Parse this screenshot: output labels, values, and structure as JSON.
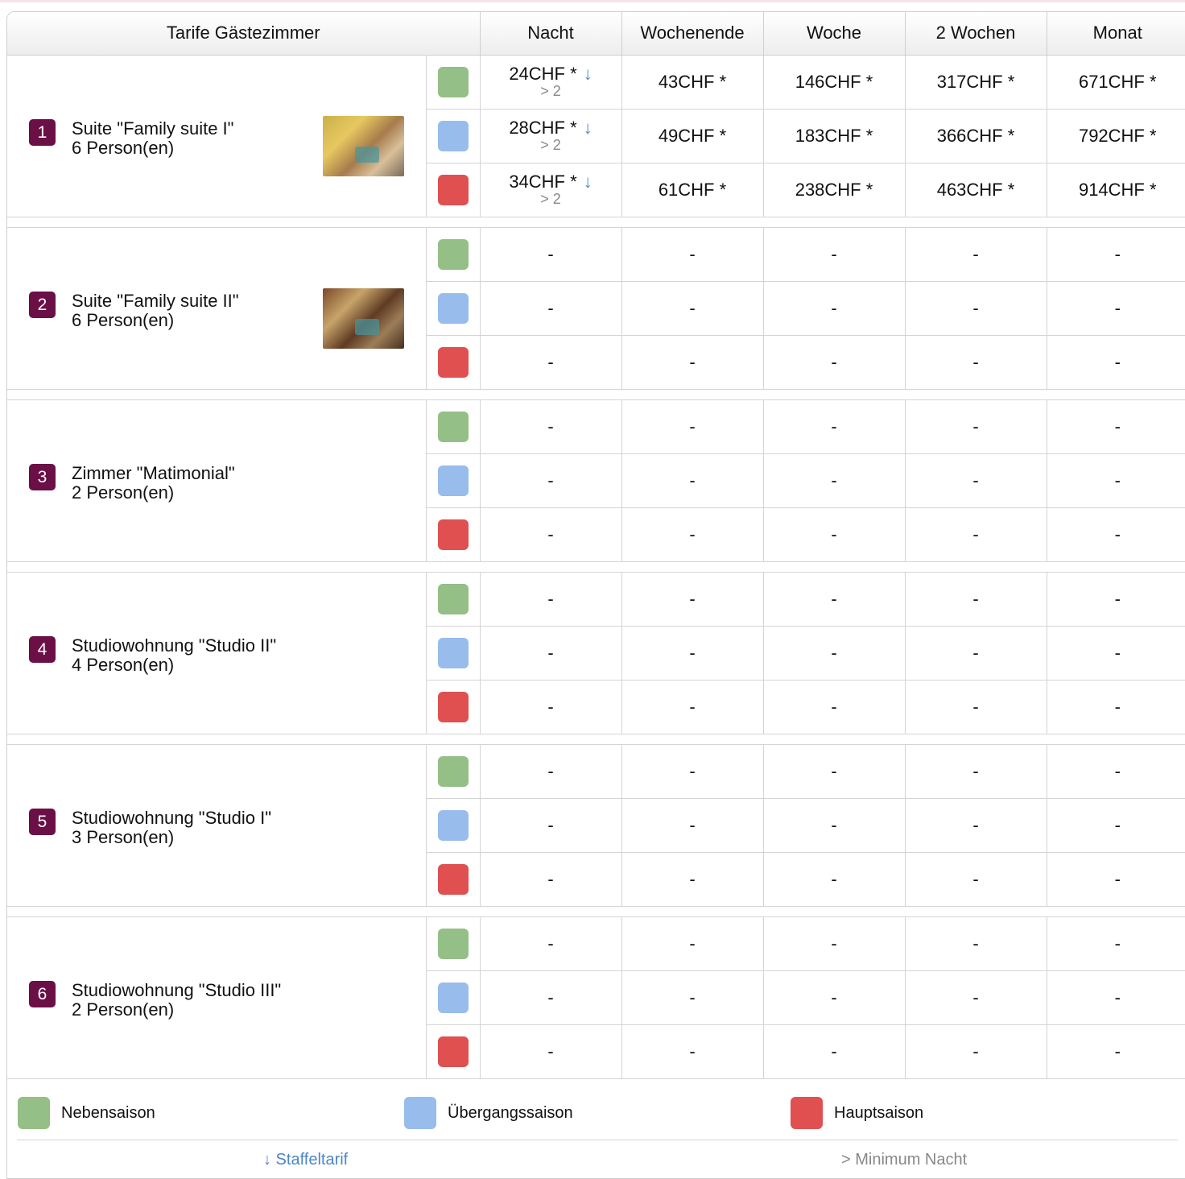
{
  "header": {
    "title": "Tarife Gästezimmer",
    "columns": [
      "Nacht",
      "Wochenende",
      "Woche",
      "2 Wochen",
      "Monat"
    ]
  },
  "colors": {
    "nebensaison": "#94bf86",
    "uebergangssaison": "#98bceb",
    "hauptsaison": "#e05050",
    "room_badge": "#6b0f47"
  },
  "rooms": [
    {
      "num": "1",
      "name": "Suite \"Family suite I\"",
      "persons": "6 Person(en)",
      "has_photo": true,
      "rates": [
        {
          "night": "24CHF *",
          "arrow": "↓",
          "min": "> 2",
          "weekend": "43CHF *",
          "week": "146CHF *",
          "two_weeks": "317CHF *",
          "month": "671CHF *"
        },
        {
          "night": "28CHF *",
          "arrow": "↓",
          "min": "> 2",
          "weekend": "49CHF *",
          "week": "183CHF *",
          "two_weeks": "366CHF *",
          "month": "792CHF *"
        },
        {
          "night": "34CHF *",
          "arrow": "↓",
          "min": "> 2",
          "weekend": "61CHF *",
          "week": "238CHF *",
          "two_weeks": "463CHF *",
          "month": "914CHF *"
        }
      ]
    },
    {
      "num": "2",
      "name": "Suite \"Family suite II\"",
      "persons": "6 Person(en)",
      "has_photo": true,
      "rates": [
        {
          "night": "-",
          "weekend": "-",
          "week": "-",
          "two_weeks": "-",
          "month": "-"
        },
        {
          "night": "-",
          "weekend": "-",
          "week": "-",
          "two_weeks": "-",
          "month": "-"
        },
        {
          "night": "-",
          "weekend": "-",
          "week": "-",
          "two_weeks": "-",
          "month": "-"
        }
      ]
    },
    {
      "num": "3",
      "name": "Zimmer \"Matimonial\"",
      "persons": "2 Person(en)",
      "has_photo": false,
      "rates": [
        {
          "night": "-",
          "weekend": "-",
          "week": "-",
          "two_weeks": "-",
          "month": "-"
        },
        {
          "night": "-",
          "weekend": "-",
          "week": "-",
          "two_weeks": "-",
          "month": "-"
        },
        {
          "night": "-",
          "weekend": "-",
          "week": "-",
          "two_weeks": "-",
          "month": "-"
        }
      ]
    },
    {
      "num": "4",
      "name": "Studiowohnung \"Studio II\"",
      "persons": "4 Person(en)",
      "has_photo": false,
      "rates": [
        {
          "night": "-",
          "weekend": "-",
          "week": "-",
          "two_weeks": "-",
          "month": "-"
        },
        {
          "night": "-",
          "weekend": "-",
          "week": "-",
          "two_weeks": "-",
          "month": "-"
        },
        {
          "night": "-",
          "weekend": "-",
          "week": "-",
          "two_weeks": "-",
          "month": "-"
        }
      ]
    },
    {
      "num": "5",
      "name": "Studiowohnung \"Studio I\"",
      "persons": "3 Person(en)",
      "has_photo": false,
      "rates": [
        {
          "night": "-",
          "weekend": "-",
          "week": "-",
          "two_weeks": "-",
          "month": "-"
        },
        {
          "night": "-",
          "weekend": "-",
          "week": "-",
          "two_weeks": "-",
          "month": "-"
        },
        {
          "night": "-",
          "weekend": "-",
          "week": "-",
          "two_weeks": "-",
          "month": "-"
        }
      ]
    },
    {
      "num": "6",
      "name": "Studiowohnung \"Studio III\"",
      "persons": "2 Person(en)",
      "has_photo": false,
      "rates": [
        {
          "night": "-",
          "weekend": "-",
          "week": "-",
          "two_weeks": "-",
          "month": "-"
        },
        {
          "night": "-",
          "weekend": "-",
          "week": "-",
          "two_weeks": "-",
          "month": "-"
        },
        {
          "night": "-",
          "weekend": "-",
          "week": "-",
          "two_weeks": "-",
          "month": "-"
        }
      ]
    }
  ],
  "legend": {
    "nebensaison": "Nebensaison",
    "uebergangssaison": "Übergangssaison",
    "hauptsaison": "Hauptsaison",
    "staffeltarif": "↓ Staffeltarif",
    "minimum_nacht": "> Minimum Nacht"
  }
}
